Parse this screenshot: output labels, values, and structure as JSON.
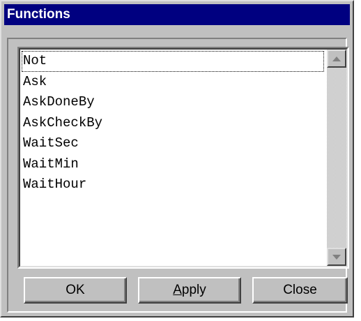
{
  "window": {
    "title": "Functions"
  },
  "functions_list": {
    "items": [
      "Not",
      "Ask",
      "AskDoneBy",
      "AskCheckBy",
      "WaitSec",
      "WaitMin",
      "WaitHour"
    ],
    "focused_index": 0
  },
  "scrollbar": {
    "up_icon": "arrow-up-icon",
    "down_icon": "arrow-down-icon"
  },
  "buttons": {
    "ok_label": "OK",
    "apply_accel": "A",
    "apply_rest": "pply",
    "close_label": "Close"
  },
  "colors": {
    "title_bar": "#000080",
    "face": "#c0c0c0",
    "list_bg": "#ffffff"
  }
}
